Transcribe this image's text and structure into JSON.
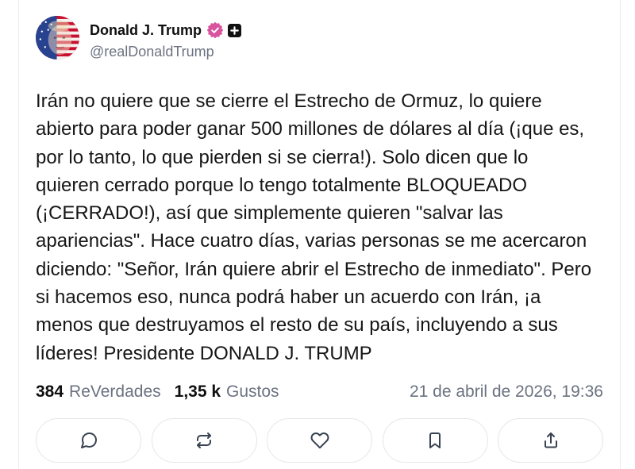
{
  "post": {
    "author": {
      "name": "Donald J. Trump",
      "handle": "@realDonaldTrump",
      "avatar_icon": "avatar-flag-portrait",
      "verified_icon": "verified-badge-icon",
      "plus_icon": "plus-badge-icon"
    },
    "body_lines": [
      "Irán no quiere que se cierre el Estrecho de Ormuz, lo quiere",
      "abierto para poder ganar 500 millones de dólares al día (¡que es,",
      "por lo tanto, lo que pierden si se cierra!). Solo dicen que lo",
      "quieren cerrado porque lo tengo totalmente BLOQUEADO",
      "(¡CERRADO!), así que simplemente quieren \"salvar las",
      "apariencias\". Hace cuatro días, varias personas se me acercaron",
      "diciendo: \"Señor, Irán quiere abrir el Estrecho de inmediato\". Pero",
      "si hacemos eso, nunca podrá haber un acuerdo con Irán, ¡a",
      "menos que destruyamos el resto de su país, incluyendo a sus",
      "líderes! Presidente DONALD J. TRUMP"
    ],
    "stats": {
      "retruths_count": "384",
      "retruths_label": "ReVerdades",
      "likes_count": "1,35 k",
      "likes_label": "Gustos",
      "timestamp": "21 de abril de 2026, 19:36"
    },
    "actions": [
      {
        "action": "reply",
        "icon": "comment-icon"
      },
      {
        "action": "retruth",
        "icon": "retruth-icon"
      },
      {
        "action": "like",
        "icon": "heart-icon"
      },
      {
        "action": "bookmark",
        "icon": "bookmark-icon"
      },
      {
        "action": "share",
        "icon": "share-icon"
      }
    ]
  },
  "colors": {
    "text": "#0f0f0f",
    "muted": "#6b7280",
    "verified": "#d9539f",
    "plus-badge": "#111111",
    "button-border": "#e4e6ea",
    "icon": "#374151",
    "card-border": "#ececec"
  }
}
